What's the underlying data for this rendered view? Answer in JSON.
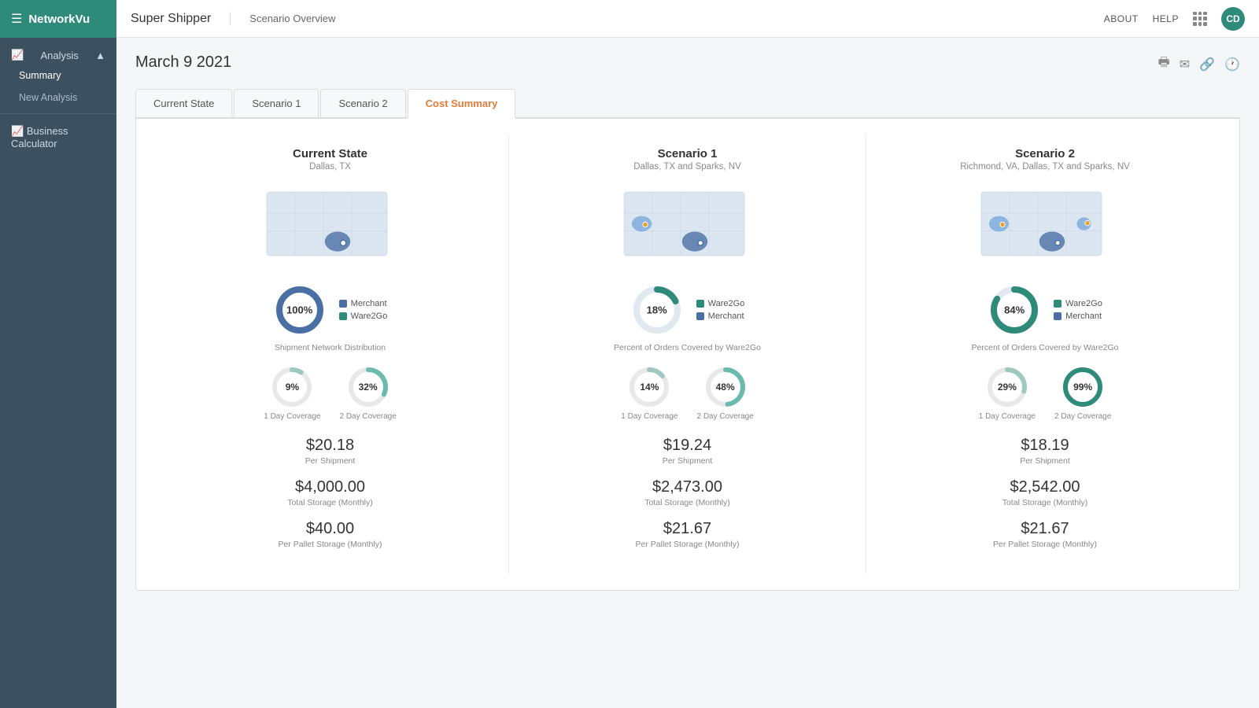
{
  "app": {
    "name": "NetworkVu"
  },
  "topbar": {
    "title": "Super Shipper",
    "subtitle": "Scenario Overview",
    "about": "ABOUT",
    "help": "HELP",
    "avatar": "CD"
  },
  "sidebar": {
    "analysis_label": "Analysis",
    "summary_label": "Summary",
    "new_analysis_label": "New Analysis",
    "business_calculator_label": "Business Calculator"
  },
  "page": {
    "date": "March 9 2021"
  },
  "tabs": [
    {
      "label": "Current State",
      "active": false
    },
    {
      "label": "Scenario 1",
      "active": false
    },
    {
      "label": "Scenario 2",
      "active": false
    },
    {
      "label": "Cost Summary",
      "active": true
    }
  ],
  "scenarios": [
    {
      "title": "Current State",
      "subtitle": "Dallas, TX",
      "donut_main_pct": 100,
      "donut_main_label": "100%",
      "donut_legend": [
        {
          "color": "#4a6fa5",
          "label": "Merchant"
        },
        {
          "color": "#2e8b7a",
          "label": "Ware2Go"
        }
      ],
      "donut_caption": "Shipment Network Distribution",
      "coverage_1day_pct": 9,
      "coverage_1day_label": "9%",
      "coverage_2day_pct": 32,
      "coverage_2day_label": "32%",
      "coverage_caption_1": "1 Day Coverage",
      "coverage_caption_2": "2 Day Coverage",
      "per_shipment": "$20.18",
      "per_shipment_label": "Per Shipment",
      "total_storage": "$4,000.00",
      "total_storage_label": "Total Storage (Monthly)",
      "per_pallet": "$40.00",
      "per_pallet_label": "Per Pallet Storage (Monthly)"
    },
    {
      "title": "Scenario 1",
      "subtitle": "Dallas, TX and Sparks, NV",
      "donut_main_pct": 18,
      "donut_main_label": "18%",
      "donut_legend": [
        {
          "color": "#2e8b7a",
          "label": "Ware2Go"
        },
        {
          "color": "#4a6fa5",
          "label": "Merchant"
        }
      ],
      "donut_caption": "Percent of Orders Covered by Ware2Go",
      "coverage_1day_pct": 14,
      "coverage_1day_label": "14%",
      "coverage_2day_pct": 48,
      "coverage_2day_label": "48%",
      "coverage_caption_1": "1 Day Coverage",
      "coverage_caption_2": "2 Day Coverage",
      "per_shipment": "$19.24",
      "per_shipment_label": "Per Shipment",
      "total_storage": "$2,473.00",
      "total_storage_label": "Total Storage (Monthly)",
      "per_pallet": "$21.67",
      "per_pallet_label": "Per Pallet Storage (Monthly)"
    },
    {
      "title": "Scenario 2",
      "subtitle": "Richmond, VA, Dallas, TX and Sparks, NV",
      "donut_main_pct": 84,
      "donut_main_label": "84%",
      "donut_legend": [
        {
          "color": "#2e8b7a",
          "label": "Ware2Go"
        },
        {
          "color": "#4a6fa5",
          "label": "Merchant"
        }
      ],
      "donut_caption": "Percent of Orders Covered by Ware2Go",
      "coverage_1day_pct": 29,
      "coverage_1day_label": "29%",
      "coverage_2day_pct": 99,
      "coverage_2day_label": "99%",
      "coverage_caption_1": "1 Day Coverage",
      "coverage_caption_2": "2 Day Coverage",
      "per_shipment": "$18.19",
      "per_shipment_label": "Per Shipment",
      "total_storage": "$2,542.00",
      "total_storage_label": "Total Storage (Monthly)",
      "per_pallet": "$21.67",
      "per_pallet_label": "Per Pallet Storage (Monthly)"
    }
  ]
}
